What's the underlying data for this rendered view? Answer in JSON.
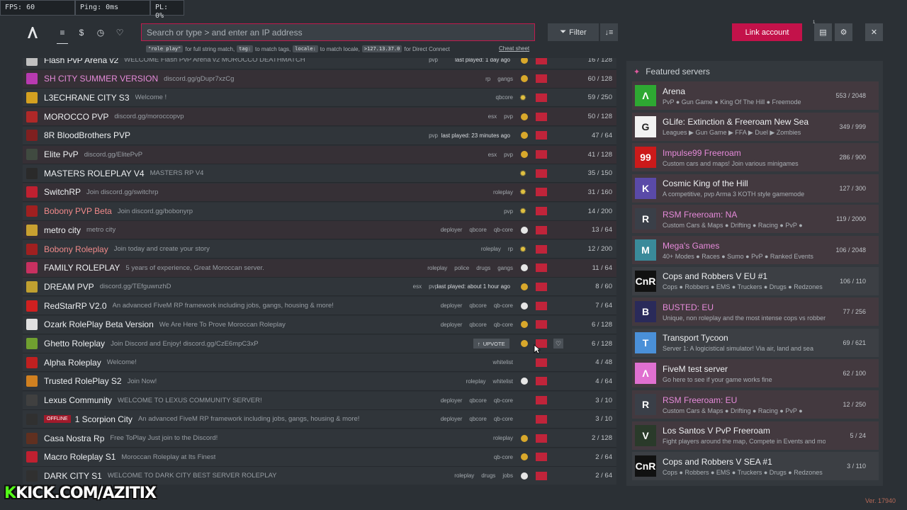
{
  "stats": {
    "fps": "FPS: 60",
    "ping": "Ping: 0ms",
    "pl": "PL: 0%"
  },
  "topbar": {
    "search_placeholder": "Search or type > and enter an IP address",
    "hints": [
      {
        "code": "\"role play\"",
        "text": "for full string match,"
      },
      {
        "code": "tag:",
        "text": "to match tags,"
      },
      {
        "code": "locale:",
        "text": "to match locale,"
      },
      {
        "code": ">127.13.37.0",
        "text": "for Direct Connect"
      }
    ],
    "cheat_sheet": "Cheat sheet",
    "filter_label": "Filter",
    "link_account": "Link account",
    "notification_count": "1"
  },
  "servers": [
    {
      "name": "Flash PvP Arena v2",
      "desc": "WELCOME Flash PvP Arena v2 MOROCCO DEATHMATCH",
      "tags": [
        "pvp"
      ],
      "last_played": "last played: 1 day ago",
      "status": "y",
      "players": "16 / 128",
      "color": "#c0c0c0"
    },
    {
      "name": "SH CITY SUMMER VERSION",
      "desc": "discord.gg/gDupr7xzCg",
      "tags": [
        "rp",
        "gangs"
      ],
      "status": "y",
      "players": "60 / 128",
      "color": "#b83ab0",
      "pink": true
    },
    {
      "name": "L3ECHRANE CITY S3",
      "desc": "Welcome !",
      "tags": [
        "qbcore"
      ],
      "status": "sun",
      "players": "59 / 250",
      "color": "#d4a020"
    },
    {
      "name": "MOROCCO PVP",
      "desc": "discord.gg/moroccopvp",
      "tags": [
        "esx",
        "pvp"
      ],
      "status": "y",
      "players": "50 / 128",
      "color": "#b02828"
    },
    {
      "name": "8R BloodBrothers PVP",
      "desc": "",
      "tags": [
        "pvp"
      ],
      "last_played": "last played: 23 minutes ago",
      "status": "y",
      "players": "47 / 64",
      "color": "#802020"
    },
    {
      "name": "Elite PvP",
      "desc": "discord.gg/ElitePvP",
      "tags": [
        "esx",
        "pvp"
      ],
      "status": "y",
      "players": "41 / 128",
      "color": "#404a40"
    },
    {
      "name": "MASTERS ROLEPLAY V4",
      "desc": "MASTERS RP V4",
      "tags": [],
      "status": "sun",
      "players": "35 / 150",
      "color": "#2a2a2a"
    },
    {
      "name": "SwitchRP",
      "desc": "Join discord.gg/switchrp",
      "tags": [
        "roleplay"
      ],
      "status": "sun",
      "players": "31 / 160",
      "color": "#c02030"
    },
    {
      "name": "Bobony PVP Beta",
      "desc": "Join discord.gg/bobonyrp",
      "tags": [
        "pvp"
      ],
      "status": "sun",
      "players": "14 / 200",
      "color": "#a02020",
      "red": true
    },
    {
      "name": "metro city",
      "desc": "metro city",
      "tags": [
        "deployer",
        "qbcore",
        "qb-core"
      ],
      "status": "w",
      "players": "13 / 64",
      "color": "#c8a030"
    },
    {
      "name": "Bobony Roleplay",
      "desc": "Join today and create your story",
      "tags": [
        "roleplay",
        "rp"
      ],
      "status": "sun",
      "players": "12 / 200",
      "color": "#a02020",
      "red": true
    },
    {
      "name": "FAMILY ROLEPLAY",
      "desc": "5 years of experience, Great Moroccan server.",
      "tags": [
        "roleplay",
        "police",
        "drugs",
        "gangs"
      ],
      "status": "w",
      "players": "11 / 64",
      "color": "#c83060"
    },
    {
      "name": "DREAM PVP",
      "desc": "discord.gg/TEfguwnzhD",
      "tags": [
        "esx",
        "pvp"
      ],
      "last_played": "last played: about 1 hour ago",
      "status": "y",
      "players": "8 / 60",
      "color": "#c0a030"
    },
    {
      "name": "RedStarRP V2.0",
      "desc": "An advanced FiveM RP framework including jobs, gangs, housing & more!",
      "tags": [
        "deployer",
        "qbcore",
        "qb-core"
      ],
      "status": "w",
      "players": "7 / 64",
      "color": "#d02020"
    },
    {
      "name": "Ozark RolePlay Beta Version",
      "desc": "We Are Here To Prove Moroccan Roleplay",
      "tags": [
        "deployer",
        "qbcore",
        "qb-core"
      ],
      "status": "y",
      "players": "6 / 128",
      "color": "#e0e0e0"
    },
    {
      "name": "Ghetto Roleplay",
      "desc": "Join Discord and Enjoy! discord.gg/CzE6mpC3xP",
      "tags": [],
      "upvote": "UPVOTE",
      "status": "y",
      "players": "6 / 128",
      "color": "#70a030"
    },
    {
      "name": "Alpha Roleplay",
      "desc": "Welcome!",
      "tags": [
        "whitelist"
      ],
      "status": "",
      "players": "4 / 48",
      "color": "#c02020"
    },
    {
      "name": "Trusted RolePlay S2",
      "desc": "Join Now!",
      "tags": [
        "roleplay",
        "whitelist"
      ],
      "status": "w",
      "players": "4 / 64",
      "color": "#d08020"
    },
    {
      "name": "Lexus Community",
      "desc": "WELCOME TO LEXUS COMMUNITY SERVER!",
      "tags": [
        "deployer",
        "qbcore",
        "qb-core"
      ],
      "status": "",
      "players": "3 / 10",
      "color": "#404040"
    },
    {
      "name": "1 Scorpion City",
      "desc": "An advanced FiveM RP framework including jobs, gangs, housing & more!",
      "tags": [
        "deployer",
        "qbcore",
        "qb-core"
      ],
      "status": "",
      "players": "3 / 10",
      "color": "#303030",
      "offline": "OFFLINE"
    },
    {
      "name": "Casa Nostra Rp",
      "desc": "Free ToPlay Just join to the Discord!",
      "tags": [
        "roleplay"
      ],
      "status": "y",
      "players": "2 / 128",
      "color": "#603020"
    },
    {
      "name": "Macro Roleplay S1",
      "desc": "Moroccan Roleplay at Its Finest",
      "tags": [
        "qb-core"
      ],
      "status": "y",
      "players": "2 / 64",
      "color": "#c02030"
    },
    {
      "name": "DARK CITY S1",
      "desc": "WELCOME TO DARK CITY BEST SERVER ROLEPLAY",
      "tags": [
        "roleplay",
        "drugs",
        "jobs"
      ],
      "status": "w",
      "players": "2 / 64",
      "color": "#303030"
    }
  ],
  "featured": {
    "title": "Featured servers",
    "items": [
      {
        "name": "Arena",
        "desc": "PvP ● Gun Game ● King Of The Hill ● Freemode",
        "players": "553 / 2048",
        "bg": "#2ea832",
        "glyph": "Λ"
      },
      {
        "name": "GLife: Extinction & Freeroam New Sea",
        "desc": "Leagues ▶ Gun Game ▶ FFA ▶ Duel ▶ Zombies",
        "players": "349 / 999",
        "bg": "#f2f2f2",
        "glyph": "G",
        "glyph_color": "#222"
      },
      {
        "name": "Impulse99 Freeroam",
        "desc": "Custom cars and maps! Join various minigames",
        "players": "286 / 900",
        "bg": "#cc1a1a",
        "glyph": "99",
        "pink": true
      },
      {
        "name": "Cosmic King of the Hill",
        "desc": "A competitive, pvp Arma 3 KOTH style gamemode",
        "players": "127 / 300",
        "bg": "#5a4aa8",
        "glyph": "K"
      },
      {
        "name": "RSM Freeroam: NA",
        "desc": "Custom Cars & Maps ● Drifting ● Racing ● PvP ●",
        "players": "119 / 2000",
        "bg": "#3a3f48",
        "glyph": "R",
        "pink": true
      },
      {
        "name": "Mega's Games",
        "desc": "40+ Modes ● Races ● Sumo ● PvP ● Ranked Events",
        "players": "106 / 2048",
        "bg": "#3a8a9a",
        "glyph": "M",
        "pink": true
      },
      {
        "name": "Cops and Robbers V EU #1",
        "desc": "Cops ● Robbers ● EMS ● Truckers ● Drugs ● Redzones",
        "players": "106 / 110",
        "bg": "#111111",
        "glyph": "CnR",
        "dark": true
      },
      {
        "name": "BUSTED: EU",
        "desc": "Unique, non roleplay and the most intense cops vs robbers",
        "players": "77 / 256",
        "bg": "#2a2a5a",
        "glyph": "B",
        "pink": true
      },
      {
        "name": "Transport Tycoon",
        "desc": "Server 1: A logicistical simulator! Via air, land and sea",
        "players": "69 / 621",
        "bg": "#4a90d8",
        "glyph": "T",
        "dark": true
      },
      {
        "name": "FiveM test server",
        "desc": "Go here to see if your game works fine",
        "players": "62 / 100",
        "bg": "#e070d0",
        "glyph": "Λ"
      },
      {
        "name": "RSM Freeroam: EU",
        "desc": "Custom Cars & Maps ● Drifting ● Racing ● PvP ●",
        "players": "12 / 250",
        "bg": "#3a3f48",
        "glyph": "R",
        "pink": true
      },
      {
        "name": "Los Santos V PvP Freeroam",
        "desc": "Fight players around the map, Compete in Events and more",
        "players": "5 / 24",
        "bg": "#2a3a2a",
        "glyph": "V"
      },
      {
        "name": "Cops and Robbers V SEA #1",
        "desc": "Cops ● Robbers ● EMS ● Truckers ● Drugs ● Redzones",
        "players": "3 / 110",
        "bg": "#111111",
        "glyph": "CnR",
        "dark": true
      }
    ]
  },
  "overlay": {
    "kick_k": "K",
    "kick_text": "KICK.COM/AZITIX"
  },
  "version": "Ver. 17940"
}
